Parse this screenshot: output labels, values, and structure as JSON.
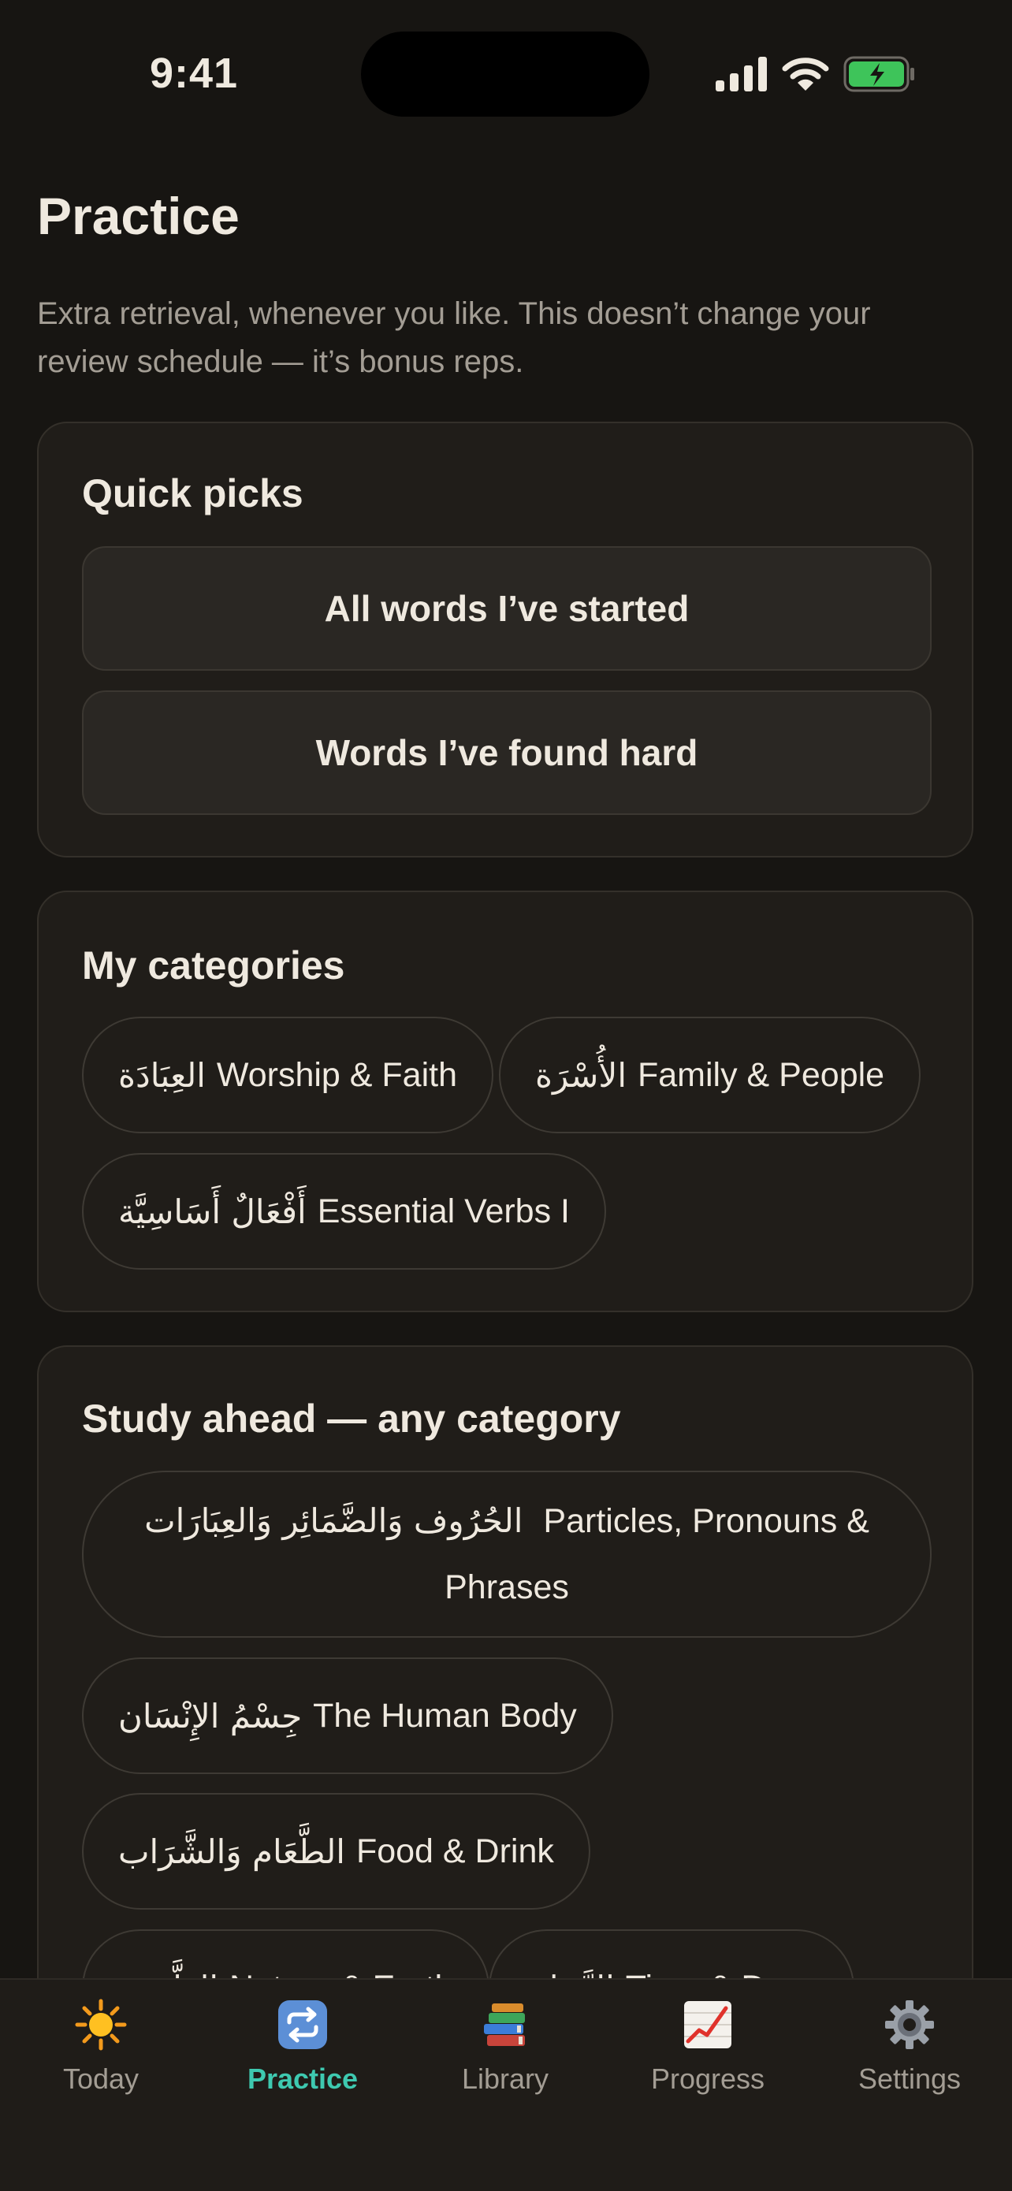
{
  "status": {
    "time": "9:41"
  },
  "page": {
    "title": "Practice",
    "subtitle": "Extra retrieval, whenever you like. This doesn’t change your review schedule — it’s bonus reps."
  },
  "quick_picks": {
    "title": "Quick picks",
    "buttons": [
      "All words I’ve started",
      "Words I’ve found hard"
    ]
  },
  "my_categories": {
    "title": "My categories",
    "items": [
      {
        "arabic": "العِبَادَة",
        "label": "Worship & Faith"
      },
      {
        "arabic": "الأُسْرَة",
        "label": "Family & People"
      },
      {
        "arabic": "أَفْعَالٌ أَسَاسِيَّة",
        "label": "Essential Verbs I"
      }
    ]
  },
  "study_ahead": {
    "title": "Study ahead — any category",
    "items": [
      {
        "arabic": "الحُرُوف وَالضَّمَائِر وَالعِبَارَات",
        "label": "Particles, Pronouns & Phrases"
      },
      {
        "arabic": "جِسْمُ الإِنْسَان",
        "label": "The Human Body"
      },
      {
        "arabic": "الطَّعَام وَالشَّرَاب",
        "label": "Food & Drink"
      },
      {
        "arabic": "الطَّبِيعَة",
        "label": "Nature & Earth"
      },
      {
        "arabic": "الزَّمَان",
        "label": "Time & Days"
      }
    ]
  },
  "tabs": [
    {
      "label": "Today",
      "icon": "sun-icon",
      "active": false
    },
    {
      "label": "Practice",
      "icon": "repeat-icon",
      "active": true
    },
    {
      "label": "Library",
      "icon": "books-icon",
      "active": false
    },
    {
      "label": "Progress",
      "icon": "chart-icon",
      "active": false
    },
    {
      "label": "Settings",
      "icon": "gear-icon",
      "active": false
    }
  ],
  "colors": {
    "background": "#171512",
    "card": "#201d19",
    "accent": "#3ec9b0",
    "battery": "#3ec45a"
  }
}
